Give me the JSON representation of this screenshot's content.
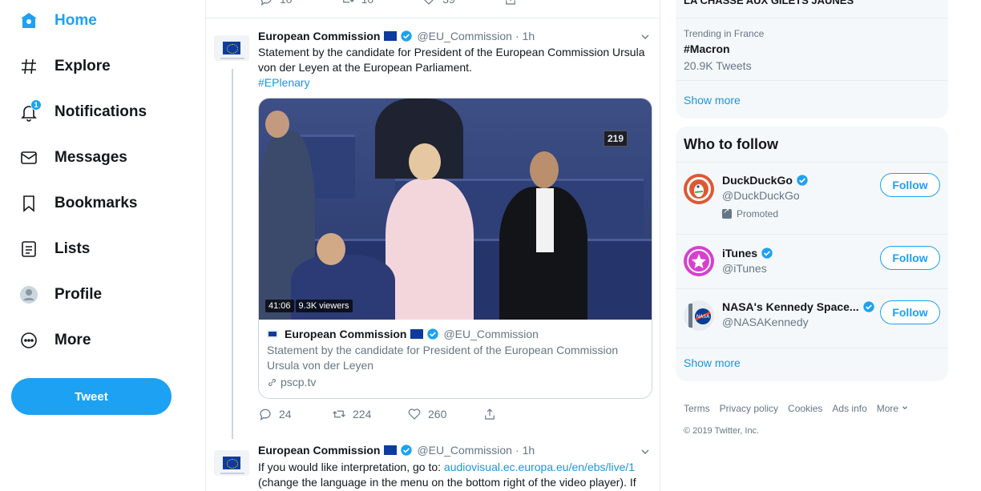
{
  "nav": {
    "items": [
      {
        "label": "Home",
        "icon": "home-icon"
      },
      {
        "label": "Explore",
        "icon": "hashtag-icon"
      },
      {
        "label": "Notifications",
        "icon": "bell-icon",
        "badge": "1"
      },
      {
        "label": "Messages",
        "icon": "envelope-icon"
      },
      {
        "label": "Bookmarks",
        "icon": "bookmark-icon"
      },
      {
        "label": "Lists",
        "icon": "list-icon"
      },
      {
        "label": "Profile",
        "icon": "avatar-icon"
      },
      {
        "label": "More",
        "icon": "more-circle-icon"
      }
    ],
    "tweet_button": "Tweet",
    "accent_color": "#1da1f2"
  },
  "prev_tweet_actions": {
    "replies": "10",
    "retweets": "10",
    "likes": "39"
  },
  "tweet1": {
    "name": "European Commission",
    "handle": "@EU_Commission",
    "dot": "·",
    "time": "1h",
    "text": "Statement by the candidate for President of the European Commission Ursula von der Leyen at the European Parliament.",
    "hashtag": "#EPlenary",
    "video": {
      "counter": "219",
      "duration": "41:06",
      "viewers": "9.3K viewers"
    },
    "card": {
      "name": "European Commission",
      "handle": "@EU_Commission",
      "text": "Statement by the candidate for President of the European Commission Ursula von der Leyen",
      "url": "pscp.tv"
    },
    "actions": {
      "replies": "24",
      "retweets": "224",
      "likes": "260"
    }
  },
  "tweet2": {
    "name": "European Commission",
    "handle": "@EU_Commission",
    "dot": "·",
    "time": "1h",
    "text_before": "If you would like interpretation, go to: ",
    "link": "audiovisual.ec.europa.eu/en/ebs/live/1",
    "text_after": "(change the language in the menu on the bottom right of the video player). If"
  },
  "trends": {
    "top_cut": "LA CHASSE AUX GILETS JAUNES",
    "meta": "Trending in France",
    "name": "#Macron",
    "count": "20.9K Tweets",
    "show_more": "Show more"
  },
  "who_to_follow": {
    "title": "Who to follow",
    "accounts": [
      {
        "name": "DuckDuckGo",
        "handle": "@DuckDuckGo",
        "promoted": "Promoted",
        "button": "Follow"
      },
      {
        "name": "iTunes",
        "handle": "@iTunes",
        "button": "Follow"
      },
      {
        "name": "NASA's Kennedy Space...",
        "handle": "@NASAKennedy",
        "button": "Follow"
      }
    ],
    "show_more": "Show more"
  },
  "footer": {
    "links": [
      "Terms",
      "Privacy policy",
      "Cookies",
      "Ads info",
      "More"
    ],
    "copyright": "© 2019 Twitter, Inc."
  }
}
